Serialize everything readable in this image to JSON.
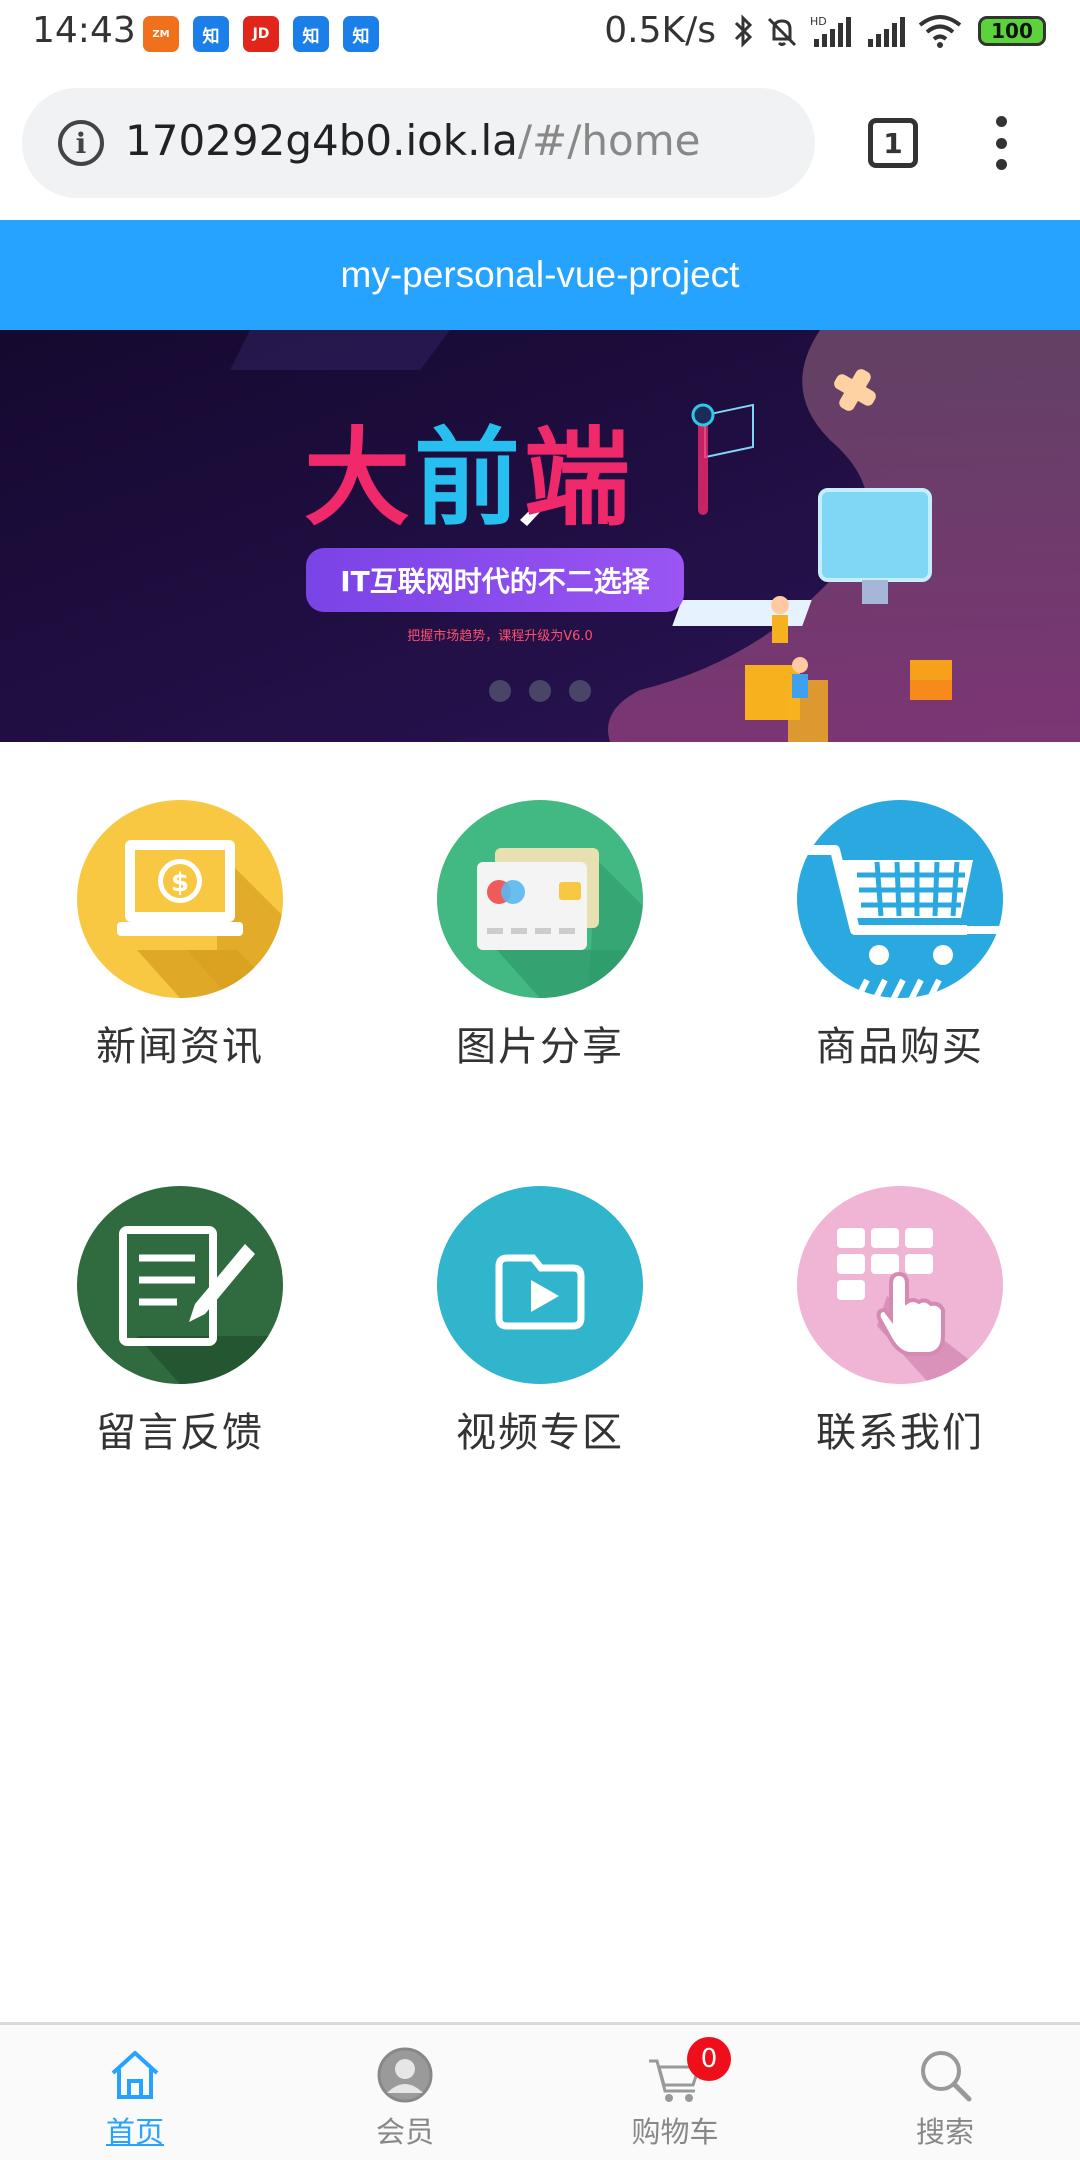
{
  "status_bar": {
    "time": "14:43",
    "notification_icons": [
      {
        "icon": "app-zm-icon",
        "label": "ZM",
        "color": "#f0701b"
      },
      {
        "icon": "zhihu-icon",
        "label": "知",
        "color": "#1a7fe8"
      },
      {
        "icon": "jd-icon",
        "label": "JD",
        "color": "#e1251b"
      },
      {
        "icon": "zhihu-icon",
        "label": "知",
        "color": "#1a7fe8"
      },
      {
        "icon": "zhihu-icon",
        "label": "知",
        "color": "#1a7fe8"
      }
    ],
    "net_speed": "0.5K/s",
    "network_type": "HD",
    "battery": "100"
  },
  "browser": {
    "url_host": "170292g4b0.iok.la",
    "url_path": "/#/home",
    "tab_count": "1"
  },
  "header": {
    "title": "my-personal-vue-project",
    "color": "#26a2ff"
  },
  "banner": {
    "title_chars": [
      "大",
      "前",
      "端"
    ],
    "subtitle": "IT互联网时代的不二选择",
    "tagline": "把握市场趋势，课程升级为V6.0",
    "slide_count": 3
  },
  "grid": {
    "items": [
      {
        "label": "新闻资讯",
        "icon": "news-laptop-icon",
        "color": "#f8c843"
      },
      {
        "label": "图片分享",
        "icon": "photo-share-card-icon",
        "color": "#42b883"
      },
      {
        "label": "商品购买",
        "icon": "shopping-cart-icon",
        "color": "#2aa8e0"
      },
      {
        "label": "留言反馈",
        "icon": "feedback-pen-icon",
        "color": "#2f6b3f"
      },
      {
        "label": "视频专区",
        "icon": "video-folder-icon",
        "color": "#30b5cc"
      },
      {
        "label": "联系我们",
        "icon": "contact-keypad-icon",
        "color": "#f0b4d4"
      }
    ]
  },
  "tabbar": {
    "items": [
      {
        "label": "首页",
        "icon": "home-icon",
        "active": true
      },
      {
        "label": "会员",
        "icon": "member-avatar-icon",
        "active": false
      },
      {
        "label": "购物车",
        "icon": "cart-icon",
        "active": false,
        "badge": "0"
      },
      {
        "label": "搜索",
        "icon": "search-icon",
        "active": false
      }
    ],
    "active_color": "#26a2ff"
  }
}
